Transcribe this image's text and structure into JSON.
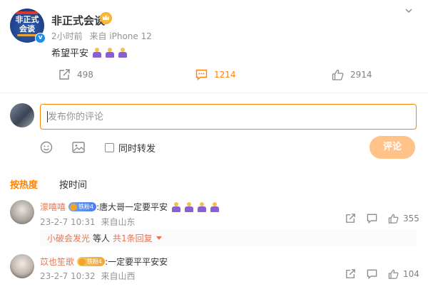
{
  "post": {
    "author": "非正式会谈",
    "avatar_text": "非正式会谈",
    "time": "2小时前",
    "source": "来自 iPhone 12",
    "text": "希望平安",
    "emoji_count": 3,
    "emoji_icon": "praying-hands-emoji",
    "stats": {
      "reposts": "498",
      "comments": "1214",
      "likes": "2914"
    }
  },
  "composer": {
    "placeholder": "发布你的评论",
    "repost_label": "同时转发",
    "submit_label": "评论"
  },
  "tabs": {
    "hot": "按热度",
    "time": "按时间"
  },
  "comments": [
    {
      "user": "濛嘻嘻",
      "badge": "铁粉4",
      "text": ":唐大哥一定要平安",
      "emoji_count": 4,
      "time": "23-2-7 10:31",
      "location": "来自山东",
      "likes": "355",
      "reply": {
        "user": "小破会发光",
        "mid": "等人",
        "link": "共1条回复"
      }
    },
    {
      "user": "苡也笙歌",
      "badge": "铁粉4",
      "text": ":一定要平平安安",
      "time": "23-2-7 10:32",
      "location": "来自山西",
      "likes": "104"
    }
  ],
  "colors": {
    "accent": "#ff8200",
    "username": "#eb7350",
    "muted": "#939393",
    "submit_disabled": "#ffc38a",
    "verified": "#1e8ff2"
  },
  "icons": [
    "chevron-down-icon",
    "share-icon",
    "comment-icon",
    "like-icon",
    "emoji-icon",
    "image-icon",
    "checkbox-icon",
    "reply-icon",
    "crown-icon",
    "verified-icon"
  ]
}
